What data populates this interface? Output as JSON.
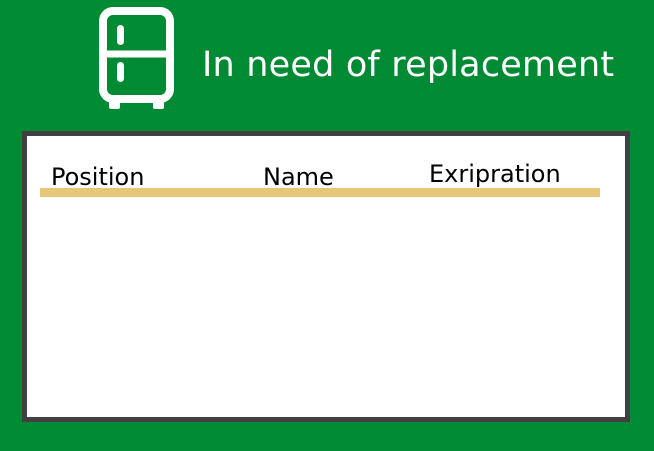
{
  "header": {
    "title": "In need of replacement",
    "icon": "fridge-icon"
  },
  "table": {
    "columns": [
      "Position",
      "Name",
      "Exripration"
    ],
    "rows": []
  },
  "colors": {
    "background": "#008a33",
    "panel_border": "#404043",
    "underline": "#e7c678",
    "title_text": "#ffffff"
  }
}
